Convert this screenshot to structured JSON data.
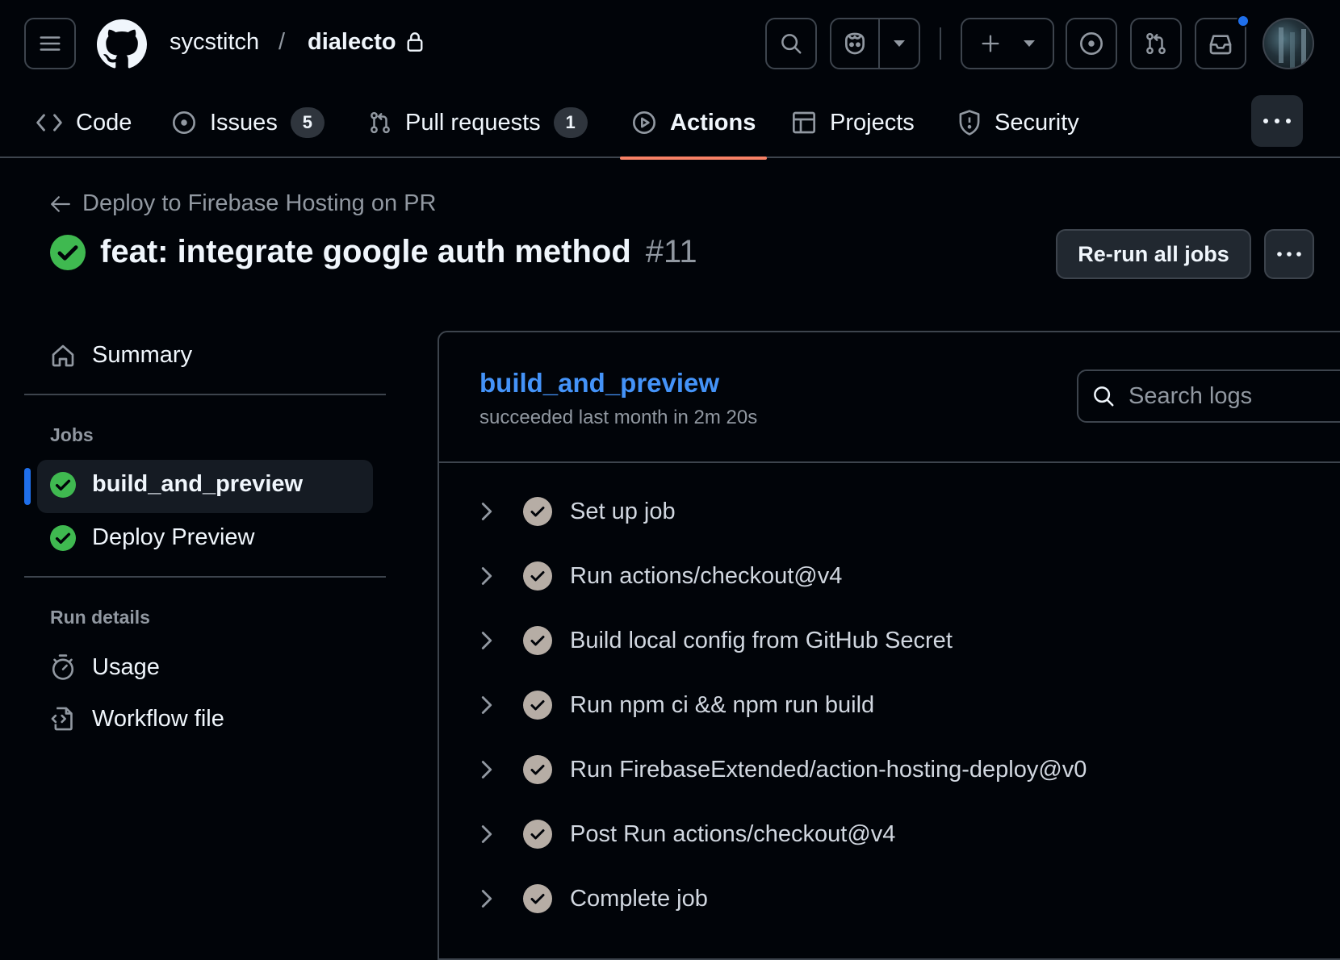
{
  "header": {
    "owner": "sycstitch",
    "separator": "/",
    "repo": "dialecto"
  },
  "nav": {
    "tabs": [
      {
        "label": "Code",
        "icon": "code-icon"
      },
      {
        "label": "Issues",
        "icon": "issue-opened-icon",
        "count": "5"
      },
      {
        "label": "Pull requests",
        "icon": "git-pull-request-icon",
        "count": "1"
      },
      {
        "label": "Actions",
        "icon": "play-icon",
        "active": true
      },
      {
        "label": "Projects",
        "icon": "table-icon"
      },
      {
        "label": "Security",
        "icon": "shield-icon"
      }
    ]
  },
  "run": {
    "back_label": "Deploy to Firebase Hosting on PR",
    "title": "feat: integrate google auth method",
    "number": "#11",
    "rerun_label": "Re-run all jobs"
  },
  "sidebar": {
    "summary_label": "Summary",
    "jobs_heading": "Jobs",
    "jobs": [
      {
        "label": "build_and_preview",
        "selected": true
      },
      {
        "label": "Deploy Preview"
      }
    ],
    "run_details_heading": "Run details",
    "details": [
      {
        "label": "Usage",
        "icon": "stopwatch-icon"
      },
      {
        "label": "Workflow file",
        "icon": "file-code-icon"
      }
    ]
  },
  "job": {
    "name": "build_and_preview",
    "meta": "succeeded last month in 2m 20s",
    "search_placeholder": "Search logs",
    "steps": [
      "Set up job",
      "Run actions/checkout@v4",
      "Build local config from GitHub Secret",
      "Run npm ci && npm run build",
      "Run FirebaseExtended/action-hosting-deploy@v0",
      "Post Run actions/checkout@v4",
      "Complete job"
    ]
  },
  "colors": {
    "background": "#010409",
    "success": "#3fb950",
    "link": "#4493f8",
    "active_tab_underline": "#f78166",
    "selected_job_bar": "#1f6feb",
    "notification_dot": "#1f6feb"
  }
}
